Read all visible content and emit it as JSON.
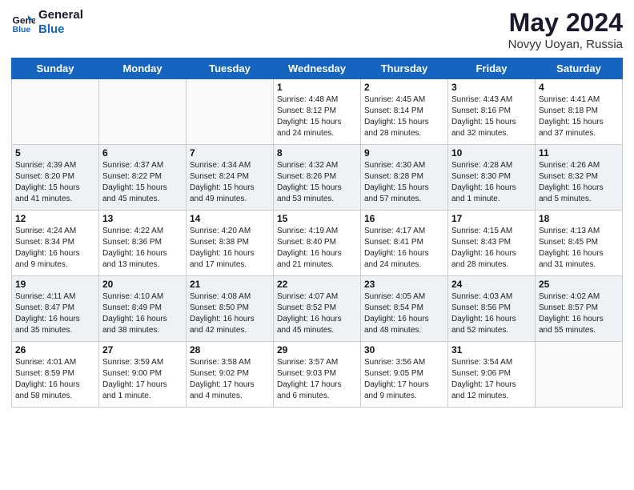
{
  "header": {
    "logo_line1": "General",
    "logo_line2": "Blue",
    "month_year": "May 2024",
    "location": "Novyy Uoyan, Russia"
  },
  "weekdays": [
    "Sunday",
    "Monday",
    "Tuesday",
    "Wednesday",
    "Thursday",
    "Friday",
    "Saturday"
  ],
  "weeks": [
    [
      {
        "day": "",
        "info": ""
      },
      {
        "day": "",
        "info": ""
      },
      {
        "day": "",
        "info": ""
      },
      {
        "day": "1",
        "info": "Sunrise: 4:48 AM\nSunset: 8:12 PM\nDaylight: 15 hours\nand 24 minutes."
      },
      {
        "day": "2",
        "info": "Sunrise: 4:45 AM\nSunset: 8:14 PM\nDaylight: 15 hours\nand 28 minutes."
      },
      {
        "day": "3",
        "info": "Sunrise: 4:43 AM\nSunset: 8:16 PM\nDaylight: 15 hours\nand 32 minutes."
      },
      {
        "day": "4",
        "info": "Sunrise: 4:41 AM\nSunset: 8:18 PM\nDaylight: 15 hours\nand 37 minutes."
      }
    ],
    [
      {
        "day": "5",
        "info": "Sunrise: 4:39 AM\nSunset: 8:20 PM\nDaylight: 15 hours\nand 41 minutes."
      },
      {
        "day": "6",
        "info": "Sunrise: 4:37 AM\nSunset: 8:22 PM\nDaylight: 15 hours\nand 45 minutes."
      },
      {
        "day": "7",
        "info": "Sunrise: 4:34 AM\nSunset: 8:24 PM\nDaylight: 15 hours\nand 49 minutes."
      },
      {
        "day": "8",
        "info": "Sunrise: 4:32 AM\nSunset: 8:26 PM\nDaylight: 15 hours\nand 53 minutes."
      },
      {
        "day": "9",
        "info": "Sunrise: 4:30 AM\nSunset: 8:28 PM\nDaylight: 15 hours\nand 57 minutes."
      },
      {
        "day": "10",
        "info": "Sunrise: 4:28 AM\nSunset: 8:30 PM\nDaylight: 16 hours\nand 1 minute."
      },
      {
        "day": "11",
        "info": "Sunrise: 4:26 AM\nSunset: 8:32 PM\nDaylight: 16 hours\nand 5 minutes."
      }
    ],
    [
      {
        "day": "12",
        "info": "Sunrise: 4:24 AM\nSunset: 8:34 PM\nDaylight: 16 hours\nand 9 minutes."
      },
      {
        "day": "13",
        "info": "Sunrise: 4:22 AM\nSunset: 8:36 PM\nDaylight: 16 hours\nand 13 minutes."
      },
      {
        "day": "14",
        "info": "Sunrise: 4:20 AM\nSunset: 8:38 PM\nDaylight: 16 hours\nand 17 minutes."
      },
      {
        "day": "15",
        "info": "Sunrise: 4:19 AM\nSunset: 8:40 PM\nDaylight: 16 hours\nand 21 minutes."
      },
      {
        "day": "16",
        "info": "Sunrise: 4:17 AM\nSunset: 8:41 PM\nDaylight: 16 hours\nand 24 minutes."
      },
      {
        "day": "17",
        "info": "Sunrise: 4:15 AM\nSunset: 8:43 PM\nDaylight: 16 hours\nand 28 minutes."
      },
      {
        "day": "18",
        "info": "Sunrise: 4:13 AM\nSunset: 8:45 PM\nDaylight: 16 hours\nand 31 minutes."
      }
    ],
    [
      {
        "day": "19",
        "info": "Sunrise: 4:11 AM\nSunset: 8:47 PM\nDaylight: 16 hours\nand 35 minutes."
      },
      {
        "day": "20",
        "info": "Sunrise: 4:10 AM\nSunset: 8:49 PM\nDaylight: 16 hours\nand 38 minutes."
      },
      {
        "day": "21",
        "info": "Sunrise: 4:08 AM\nSunset: 8:50 PM\nDaylight: 16 hours\nand 42 minutes."
      },
      {
        "day": "22",
        "info": "Sunrise: 4:07 AM\nSunset: 8:52 PM\nDaylight: 16 hours\nand 45 minutes."
      },
      {
        "day": "23",
        "info": "Sunrise: 4:05 AM\nSunset: 8:54 PM\nDaylight: 16 hours\nand 48 minutes."
      },
      {
        "day": "24",
        "info": "Sunrise: 4:03 AM\nSunset: 8:56 PM\nDaylight: 16 hours\nand 52 minutes."
      },
      {
        "day": "25",
        "info": "Sunrise: 4:02 AM\nSunset: 8:57 PM\nDaylight: 16 hours\nand 55 minutes."
      }
    ],
    [
      {
        "day": "26",
        "info": "Sunrise: 4:01 AM\nSunset: 8:59 PM\nDaylight: 16 hours\nand 58 minutes."
      },
      {
        "day": "27",
        "info": "Sunrise: 3:59 AM\nSunset: 9:00 PM\nDaylight: 17 hours\nand 1 minute."
      },
      {
        "day": "28",
        "info": "Sunrise: 3:58 AM\nSunset: 9:02 PM\nDaylight: 17 hours\nand 4 minutes."
      },
      {
        "day": "29",
        "info": "Sunrise: 3:57 AM\nSunset: 9:03 PM\nDaylight: 17 hours\nand 6 minutes."
      },
      {
        "day": "30",
        "info": "Sunrise: 3:56 AM\nSunset: 9:05 PM\nDaylight: 17 hours\nand 9 minutes."
      },
      {
        "day": "31",
        "info": "Sunrise: 3:54 AM\nSunset: 9:06 PM\nDaylight: 17 hours\nand 12 minutes."
      },
      {
        "day": "",
        "info": ""
      }
    ]
  ]
}
